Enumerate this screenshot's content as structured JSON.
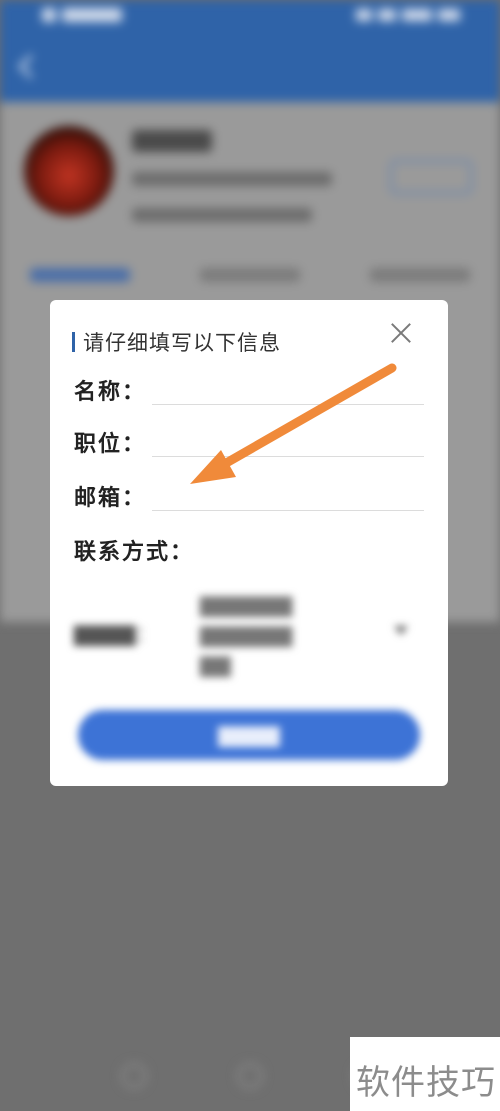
{
  "dialog": {
    "title": "请仔细填写以下信息",
    "fields": [
      {
        "label": "名称：",
        "value": ""
      },
      {
        "label": "职位：",
        "value": ""
      },
      {
        "label": "邮箱：",
        "value": ""
      }
    ],
    "contact_label": "联系方式："
  },
  "watermark": {
    "text": "软件技巧"
  },
  "colors": {
    "header": "#2f63a8",
    "button": "#3d73d6",
    "annotation_arrow": "#f08a3a"
  },
  "icons": {
    "close": "close-icon",
    "annotation": "arrow-annotation"
  }
}
